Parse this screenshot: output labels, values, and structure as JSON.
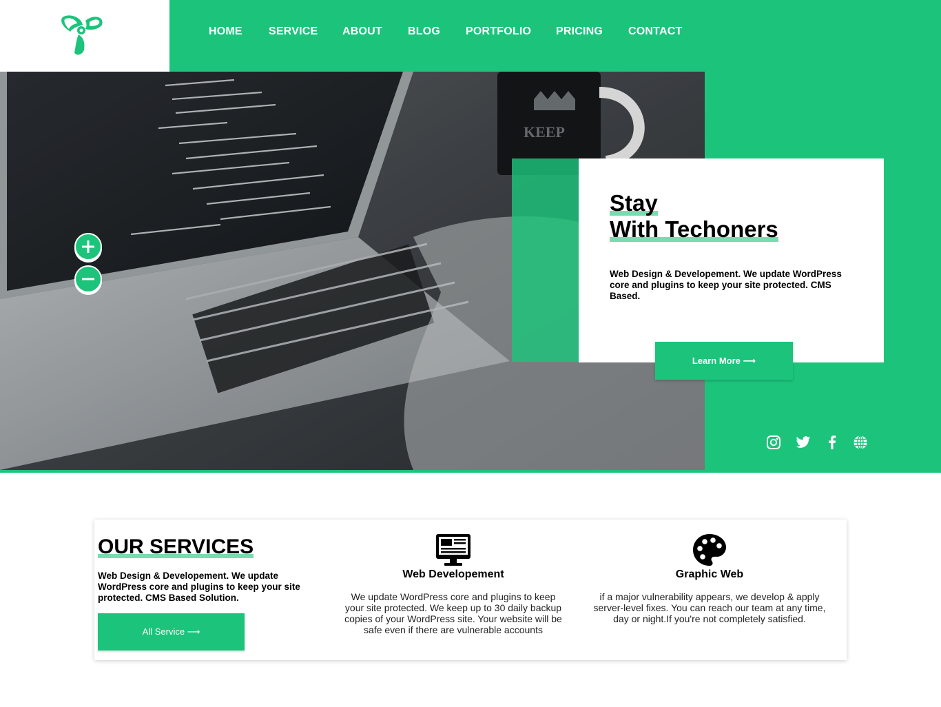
{
  "colors": {
    "accent": "#1cc47b",
    "white": "#ffffff",
    "text": "#000000"
  },
  "header": {
    "logo": "techoners-logo-icon",
    "nav": [
      {
        "label": "HOME"
      },
      {
        "label": "SERVICE"
      },
      {
        "label": "ABOUT"
      },
      {
        "label": "BLOG"
      },
      {
        "label": "PORTFOLIO"
      },
      {
        "label": "PRICING"
      },
      {
        "label": "CONTACT"
      }
    ]
  },
  "hero": {
    "title_line1": "Stay",
    "title_line2": "With Techoners",
    "description": "Web Design & Developement. We update WordPress core and plugins to keep your site protected. CMS Based.",
    "cta_label": "Learn More ⟶",
    "zoom_controls": [
      "plus-icon",
      "minus-icon"
    ],
    "social": [
      "instagram-icon",
      "twitter-icon",
      "facebook-icon",
      "globe-icon"
    ]
  },
  "services": {
    "title": "OUR SERVICES",
    "description": "Web Design & Developement. We update WordPress core and plugins to keep your site protected. CMS Based Solution.",
    "button_label": "All Service ⟶",
    "items": [
      {
        "icon": "monitor-icon",
        "title": "Web Developement",
        "text": "We update WordPress core and plugins to keep your site protected. We keep up to 30 daily backup copies of your WordPress site. Your website will be safe even if there are vulnerable accounts"
      },
      {
        "icon": "palette-icon",
        "title": "Graphic Web",
        "text": "if a major vulnerability appears, we develop & apply server-level fixes. You can reach our team at any time, day or night.If you're not completely satisfied."
      }
    ]
  }
}
